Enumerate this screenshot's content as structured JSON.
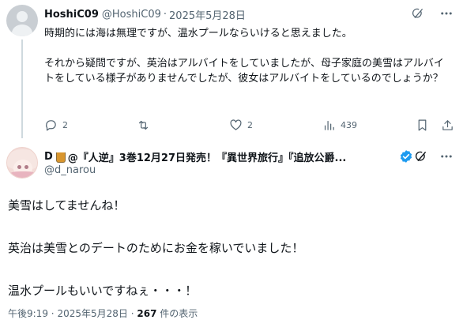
{
  "reply": {
    "name": "HoshiC09",
    "handle": "@HoshiC09",
    "separator": "·",
    "date": "2025年5月28日",
    "paragraphs": [
      "時期的には海は無理ですが、温水プールならいけると思えました。",
      "それから疑問ですが、英治はアルバイトをしていましたが、母子家庭の美雪はアルバイトをしている様子がありませんでしたが、彼女はアルバイトをしているのでしょうか？"
    ],
    "actions": {
      "reply_count": "2",
      "retweet_count": "",
      "like_count": "2",
      "view_count": "439"
    }
  },
  "main": {
    "display_name": "D🥃@『人逆』3巻12月27日発売！『異世界旅行』『追放公爵...",
    "name_prefix": "D",
    "name_text": "@『人逆』3巻12月27日発売！『異世界旅行』『追放公爵...",
    "handle": "@d_narou",
    "paragraphs": [
      "美雪はしてませんね！",
      "英治は美雪とのデートのためにお金を稼いでいました！",
      "温水プールもいいですねぇ・・・！"
    ],
    "meta": {
      "time": "午後9:19",
      "separator": "·",
      "date": "2025年5月28日",
      "views_count": "267",
      "views_label": "件の表示"
    }
  },
  "colors": {
    "text": "#0f1419",
    "secondary": "#536471",
    "verified": "#1d9bf0",
    "divider": "#cfd9de"
  }
}
